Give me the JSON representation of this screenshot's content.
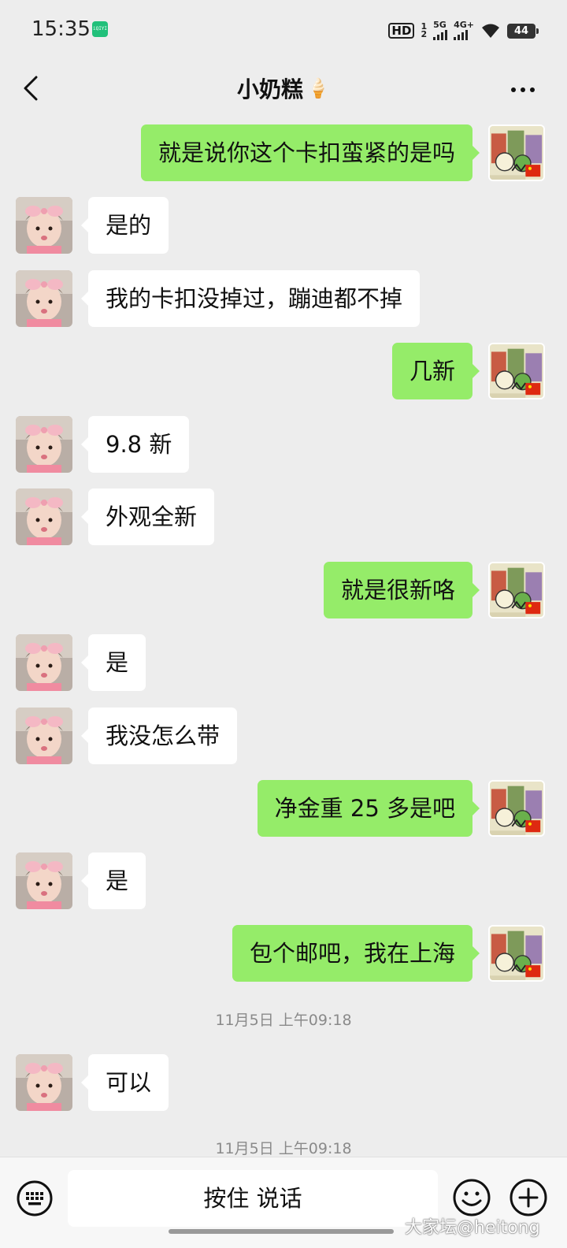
{
  "status_bar": {
    "time": "15:35",
    "app_badge": "iQIYI",
    "hd_label": "HD",
    "hd_sub_top": "1",
    "hd_sub_bottom": "2",
    "network1": "5G",
    "network2": "4G+",
    "battery": "44"
  },
  "nav": {
    "title": "小奶糕",
    "title_emoji": "🍦"
  },
  "messages": [
    {
      "side": "out",
      "text": "就是说你这个卡扣蛮紧的是吗"
    },
    {
      "side": "in",
      "text": "是的"
    },
    {
      "side": "in",
      "text": "我的卡扣没掉过，蹦迪都不掉"
    },
    {
      "side": "out",
      "text": "几新"
    },
    {
      "side": "in",
      "text": "9.8 新"
    },
    {
      "side": "in",
      "text": "外观全新"
    },
    {
      "side": "out",
      "text": "就是很新咯"
    },
    {
      "side": "in",
      "text": "是"
    },
    {
      "side": "in",
      "text": "我没怎么带"
    },
    {
      "side": "out",
      "text": "净金重 25 多是吧"
    },
    {
      "side": "in",
      "text": "是"
    },
    {
      "side": "out",
      "text": "包个邮吧，我在上海"
    },
    {
      "side": "time",
      "text": "11月5日 上午09:18"
    },
    {
      "side": "in",
      "text": "可以"
    },
    {
      "side": "time",
      "text": "11月5日 上午09:18"
    }
  ],
  "input_bar": {
    "voice_label": "按住 说话"
  },
  "watermark": "大家坛@heitong",
  "colors": {
    "background": "#ededed",
    "outgoing_bubble": "#95ec69",
    "incoming_bubble": "#ffffff",
    "timestamp": "#8a8a8a"
  },
  "icons": [
    "back-icon",
    "more-icon",
    "keyboard-icon",
    "emoji-icon",
    "plus-icon",
    "wifi-icon",
    "signal-icon",
    "battery-icon"
  ]
}
